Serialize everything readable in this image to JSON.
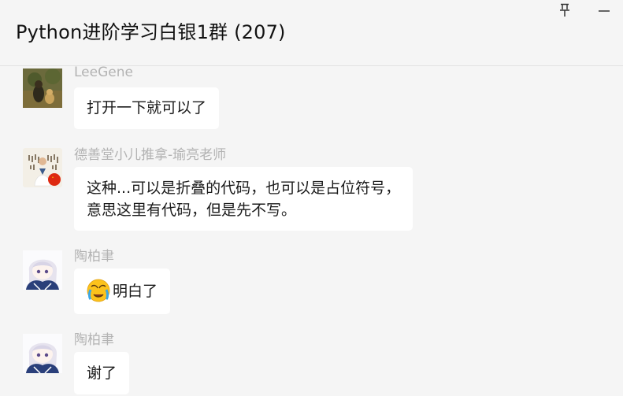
{
  "window": {
    "title": "Python进阶学习白银1群 (207)",
    "pin_icon": "pin-icon",
    "minimize_icon": "minimize-icon"
  },
  "messages": [
    {
      "sender": "LeeGene",
      "avatar": "avatar-leegene",
      "lines": [
        "打开一下就可以了"
      ]
    },
    {
      "sender": "德善堂小儿推拿-瑜亮老师",
      "avatar": "avatar-deshantang",
      "lines": [
        "这种...可以是折叠的代码，也可以是占位符号，",
        "意思这里有代码，但是先不写。"
      ]
    },
    {
      "sender": "陶柏聿",
      "avatar": "avatar-taobaiyu",
      "emoji": "facepalm-crying-emoji",
      "lines": [
        "明白了"
      ]
    },
    {
      "sender": "陶柏聿",
      "avatar": "avatar-taobaiyu",
      "lines": [
        "谢了"
      ]
    }
  ]
}
